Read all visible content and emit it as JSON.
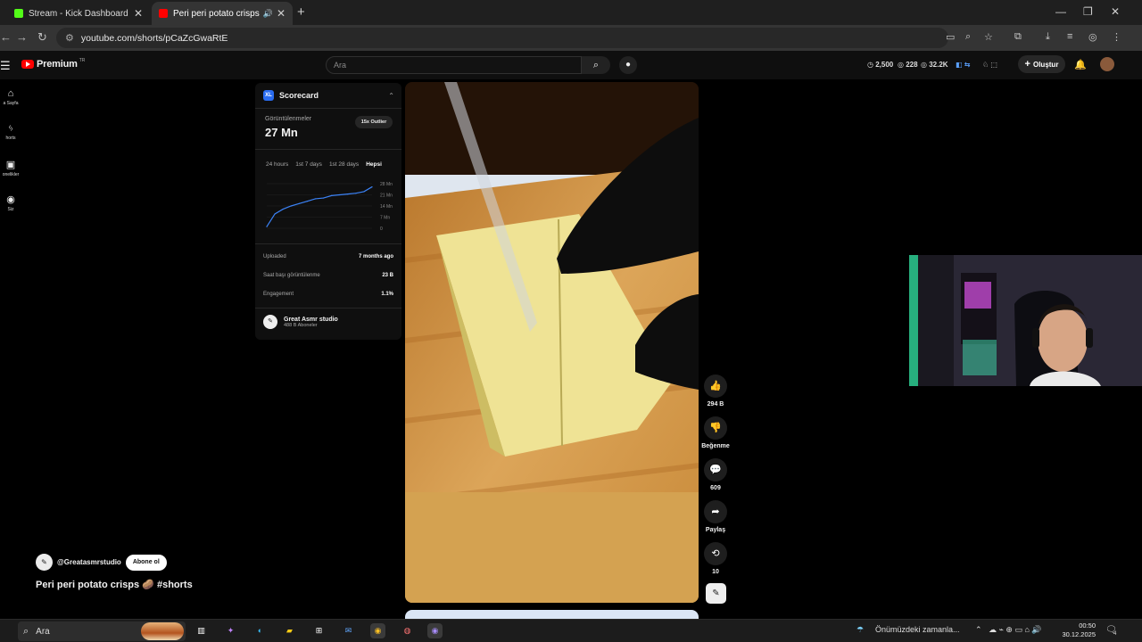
{
  "browser": {
    "tabs": [
      {
        "title": "Stream - Kick Dashboard",
        "active": false
      },
      {
        "title": "Peri peri potato crisps 🥔 #",
        "active": true
      }
    ],
    "url": "youtube.com/shorts/pCaZcGwaRtE"
  },
  "youtube": {
    "brand": "Premium",
    "region": "TR",
    "search_placeholder": "Ara",
    "ext_stats": [
      "2,500",
      "228",
      "32.2K"
    ],
    "create_label": "Oluştur",
    "left_nav": [
      "a Sayfa",
      "horts",
      "onelikler",
      "Siz"
    ]
  },
  "scorecard": {
    "title": "Scorecard",
    "views_label": "Görüntülenmeler",
    "views_value": "27 Mn",
    "outlier_badge": "15x Outlier",
    "ranges": [
      "24 hours",
      "1st 7 days",
      "1st 28 days",
      "Hepsi"
    ],
    "active_range": "Hepsi",
    "chart_y_ticks": [
      "28 Mn",
      "21 Mn",
      "14 Mn",
      "7 Mn",
      "0"
    ],
    "metrics": [
      {
        "label": "Uploaded",
        "value": "7 months ago"
      },
      {
        "label": "Saat başı görüntülenme",
        "value": "23 B"
      },
      {
        "label": "Engagement",
        "value": "1.1%"
      }
    ],
    "channel_name": "Great Asmr studio",
    "channel_subs": "488 B Aboneler"
  },
  "chart_data": {
    "type": "line",
    "y_ticks": [
      "28 Mn",
      "21 Mn",
      "14 Mn",
      "7 Mn",
      "0"
    ],
    "ylim": [
      0,
      28
    ],
    "series": [
      {
        "values": [
          1,
          9,
          12,
          14,
          15.5,
          17,
          18.5,
          19,
          20.5,
          21,
          21.5,
          22,
          23,
          26
        ]
      }
    ]
  },
  "actions": [
    {
      "icon": "like",
      "label": "294 B"
    },
    {
      "icon": "dislike",
      "label": "Beğenme"
    },
    {
      "icon": "comment",
      "label": "609"
    },
    {
      "icon": "share",
      "label": "Paylaş"
    },
    {
      "icon": "remix",
      "label": "10"
    }
  ],
  "video": {
    "handle": "@Greatasmrstudio",
    "subscribe_label": "Abone ol",
    "title": "Peri peri potato crisps 🥔 #shorts"
  },
  "taskbar": {
    "search_placeholder": "Ara",
    "weather_text": "Önümüzdeki zamanla...",
    "time": "00:50",
    "date": "30.12.2025",
    "notif_count": "4"
  },
  "colors": {
    "accent_blue": "#2a6cf0",
    "yt_red": "#ff0000",
    "chart_line": "#3b82f6"
  }
}
